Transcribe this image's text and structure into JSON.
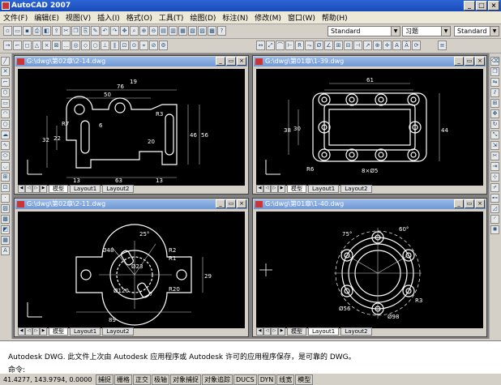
{
  "app": {
    "title": "AutoCAD 2007"
  },
  "menu": [
    "文件(F)",
    "编辑(E)",
    "视图(V)",
    "插入(I)",
    "格式(O)",
    "工具(T)",
    "绘图(D)",
    "标注(N)",
    "修改(M)",
    "窗口(W)",
    "帮助(H)"
  ],
  "toolbar": {
    "text_style": "Standard",
    "dim_style": "习题",
    "table_style": "Standard"
  },
  "drawings": [
    {
      "title": "G:\\dwg\\第02章\\2-14.dwg",
      "tabs": [
        "模型",
        "Layout1",
        "Layout2"
      ]
    },
    {
      "title": "G:\\dwg\\第01章\\1-39.dwg",
      "tabs": [
        "模型",
        "Layout1",
        "Layout2"
      ]
    },
    {
      "title": "G:\\dwg\\第02章\\2-11.dwg",
      "tabs": [
        "模型",
        "Layout1",
        "Layout2"
      ]
    },
    {
      "title": "G:\\dwg\\第01章\\1-40.dwg",
      "tabs": [
        "模型",
        "Layout1",
        "Layout2"
      ]
    }
  ],
  "command": {
    "line1": "Autodesk DWG.  此文件上次由 Autodesk 应用程序或 Autodesk 许可的应用程序保存，是可靠的 DWG。",
    "line2": "命令:"
  },
  "status": {
    "coords": "41.4277, 143.9794, 0.0000",
    "buttons": [
      "捕捉",
      "栅格",
      "正交",
      "极轴",
      "对象捕捉",
      "对象追踪",
      "DUCS",
      "DYN",
      "线宽",
      "模型"
    ]
  }
}
